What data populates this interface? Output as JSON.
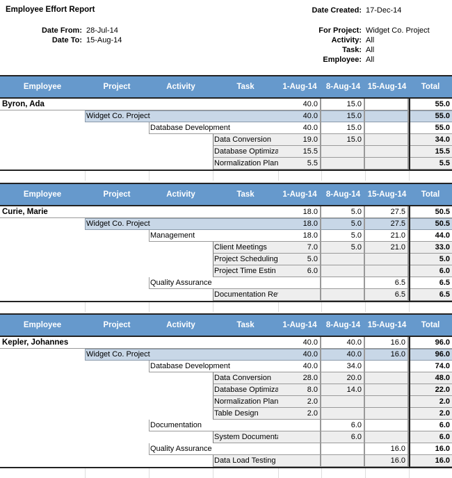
{
  "report": {
    "title": "Employee Effort Report",
    "date_from_label": "Date From:",
    "date_from": "28-Jul-14",
    "date_to_label": "Date To:",
    "date_to": "15-Aug-14",
    "date_created_label": "Date Created:",
    "date_created": "17-Dec-14",
    "for_project_label": "For Project:",
    "for_project": "Widget Co. Project",
    "activity_label": "Activity:",
    "activity": "All",
    "task_label": "Task:",
    "task": "All",
    "employee_label": "Employee:",
    "employee": "All"
  },
  "columns": [
    "Employee",
    "Project",
    "Activity",
    "Task",
    "1-Aug-14",
    "8-Aug-14",
    "15-Aug-14",
    "Total"
  ],
  "colors": {
    "header_bg": "#6699cc",
    "project_band": "#c8d7e7",
    "task_band": "#eeeeee"
  },
  "employees": [
    {
      "name": "Byron, Ada",
      "values": [
        "40.0",
        "15.0",
        "",
        "55.0"
      ],
      "project": {
        "name": "Widget Co. Project",
        "values": [
          "40.0",
          "15.0",
          "",
          "55.0"
        ]
      },
      "activities": [
        {
          "name": "Database Development",
          "values": [
            "40.0",
            "15.0",
            "",
            "55.0"
          ],
          "tasks": [
            {
              "name": "Data Conversion",
              "values": [
                "19.0",
                "15.0",
                "",
                "34.0"
              ]
            },
            {
              "name": "Database Optimiza",
              "values": [
                "15.5",
                "",
                "",
                "15.5"
              ]
            },
            {
              "name": "Normalization Plan",
              "values": [
                "5.5",
                "",
                "",
                "5.5"
              ]
            }
          ]
        }
      ]
    },
    {
      "name": "Curie, Marie",
      "values": [
        "18.0",
        "5.0",
        "27.5",
        "50.5"
      ],
      "project": {
        "name": "Widget Co. Project",
        "values": [
          "18.0",
          "5.0",
          "27.5",
          "50.5"
        ]
      },
      "activities": [
        {
          "name": "Management",
          "values": [
            "18.0",
            "5.0",
            "21.0",
            "44.0"
          ],
          "tasks": [
            {
              "name": "Client Meetings",
              "values": [
                "7.0",
                "5.0",
                "21.0",
                "33.0"
              ]
            },
            {
              "name": "Project Scheduling",
              "values": [
                "5.0",
                "",
                "",
                "5.0"
              ]
            },
            {
              "name": "Project Time Estin",
              "values": [
                "6.0",
                "",
                "",
                "6.0"
              ]
            }
          ]
        },
        {
          "name": "Quality Assurance",
          "values": [
            "",
            "",
            "6.5",
            "6.5"
          ],
          "tasks": [
            {
              "name": "Documentation Review",
              "values": [
                "",
                "",
                "6.5",
                "6.5"
              ]
            }
          ]
        }
      ]
    },
    {
      "name": "Kepler, Johannes",
      "values": [
        "40.0",
        "40.0",
        "16.0",
        "96.0"
      ],
      "project": {
        "name": "Widget Co. Project",
        "values": [
          "40.0",
          "40.0",
          "16.0",
          "96.0"
        ]
      },
      "activities": [
        {
          "name": "Database Development",
          "values": [
            "40.0",
            "34.0",
            "",
            "74.0"
          ],
          "tasks": [
            {
              "name": "Data Conversion",
              "values": [
                "28.0",
                "20.0",
                "",
                "48.0"
              ]
            },
            {
              "name": "Database Optimiza",
              "values": [
                "8.0",
                "14.0",
                "",
                "22.0"
              ]
            },
            {
              "name": "Normalization Plan",
              "values": [
                "2.0",
                "",
                "",
                "2.0"
              ]
            },
            {
              "name": "Table Design",
              "values": [
                "2.0",
                "",
                "",
                "2.0"
              ]
            }
          ]
        },
        {
          "name": "Documentation",
          "values": [
            "",
            "6.0",
            "",
            "6.0"
          ],
          "tasks": [
            {
              "name": "System Documentation",
              "values": [
                "",
                "6.0",
                "",
                "6.0"
              ]
            }
          ]
        },
        {
          "name": "Quality Assurance",
          "values": [
            "",
            "",
            "16.0",
            "16.0"
          ],
          "tasks": [
            {
              "name": "Data Load Testing",
              "values": [
                "",
                "",
                "16.0",
                "16.0"
              ]
            }
          ]
        }
      ]
    }
  ]
}
